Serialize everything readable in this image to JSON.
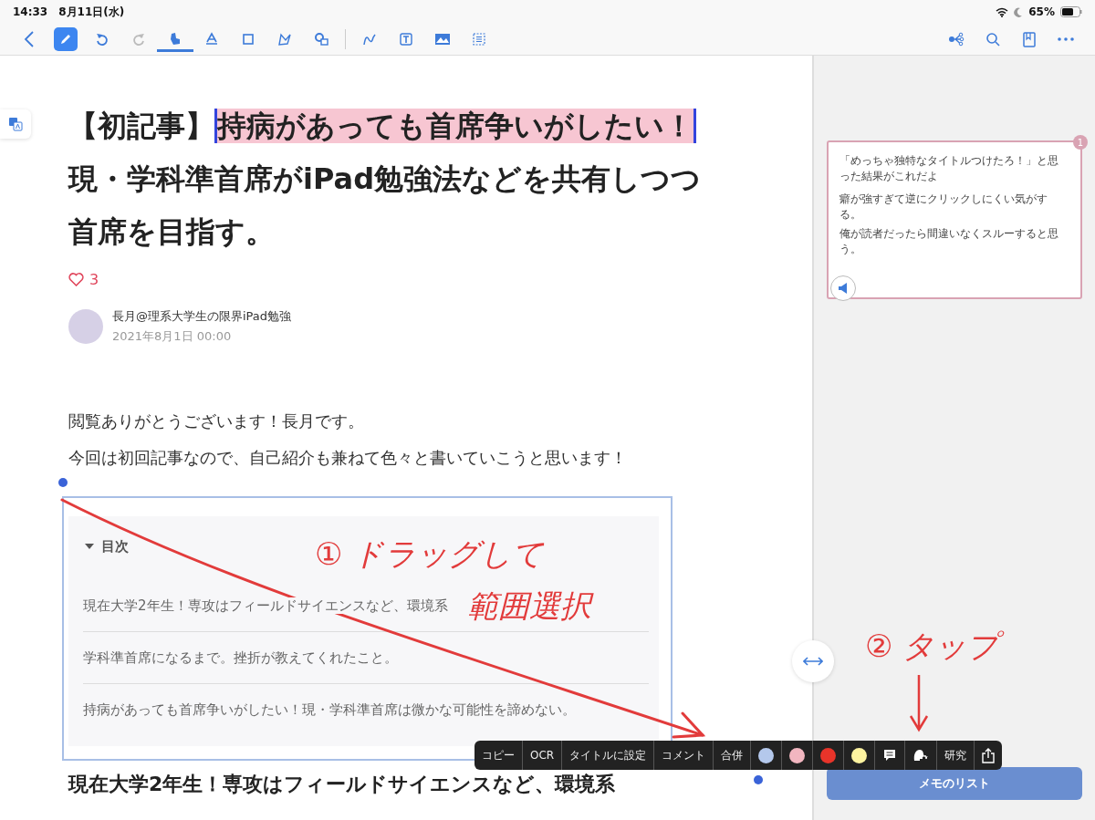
{
  "status_bar": {
    "time": "14:33",
    "date": "8月11日(水)",
    "battery": "65%"
  },
  "toolbar": {
    "pen_active": true,
    "redo_disabled": true,
    "tools": [
      {
        "selected": true
      },
      {
        "selected": false
      },
      {
        "selected": false
      },
      {
        "selected": false
      },
      {
        "selected": false
      }
    ]
  },
  "article": {
    "title_parts": [
      {
        "text": "【初記事】",
        "highlighted": false
      },
      {
        "text": "持病があっても首席争いがしたい！",
        "highlighted": true
      },
      {
        "text": "現・学科準首席がiPad勉強法などを共有しつつ首席を目指す。",
        "highlighted": false
      }
    ],
    "likes": "3",
    "author": "長月@理系大学生の限界iPad勉強",
    "date": "2021年8月1日 00:00",
    "paragraphs": [
      "閲覧ありがとうございます！長月です。",
      "今回は初回記事なので、自己紹介も兼ねて色々と書いていこうと思います！"
    ],
    "toc": {
      "title": "目次",
      "items": [
        "現在大学2年生！専攻はフィールドサイエンスなど、環境系",
        "学科準首席になるまで。挫折が教えてくれたこと。",
        "持病があっても首席争いがしたい！現・学科準首席は微かな可能性を諦めない。"
      ]
    },
    "next_heading": "現在大学2年生！専攻はフィールドサイエンスなど、環境系"
  },
  "popup_menu": {
    "actions": [
      "コピー",
      "OCR",
      "タイトルに設定",
      "コメント",
      "合併"
    ],
    "colors": [
      {
        "color": "#b4c8ec"
      },
      {
        "color": "#f2b6c0"
      },
      {
        "color": "#e8342a"
      },
      {
        "color": "#fdf3a0"
      }
    ],
    "research": "研究"
  },
  "annotations": [
    {
      "text": "① ドラッグして"
    },
    {
      "text": "範囲選択"
    },
    {
      "text": "② タップ"
    }
  ],
  "memo_panel": {
    "note": {
      "badge": "1",
      "paragraphs": [
        "「めっちゃ独特なタイトルつけたろ！」と思った結果がこれだよ",
        "癖が強すぎて逆にクリックしにくい気がする。",
        "俺が読者だったら間違いなくスルーすると思う。"
      ]
    },
    "list_button": "メモのリスト"
  }
}
